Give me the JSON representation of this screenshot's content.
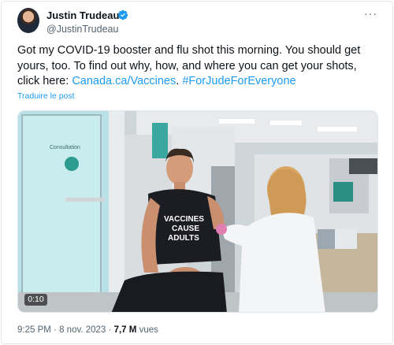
{
  "author": {
    "name": "Justin Trudeau",
    "handle": "@JustinTrudeau"
  },
  "menu": {
    "more_label": "···"
  },
  "tweet": {
    "text_part1": "Got my COVID-19 booster and flu shot this morning. You should get yours, too. To find out why, how, and where you can get your shots, click here: ",
    "link": "Canada.ca/Vaccines",
    "text_part2": ". ",
    "hashtag": "#ForJudeForEveryone",
    "translate_label": "Traduire le post"
  },
  "media": {
    "duration": "0:10",
    "shirt_text_line1": "VACCINES",
    "shirt_text_line2": "CAUSE",
    "shirt_text_line3": "ADULTS",
    "sign_text": "Consultation"
  },
  "meta": {
    "time": "9:25 PM",
    "separator": "·",
    "date": "8 nov. 2023",
    "views_count": "7,7 M",
    "views_label": "vues"
  },
  "colors": {
    "link": "#1d9bf0",
    "verified": "#1d9bf0",
    "secondary_text": "#536471"
  }
}
